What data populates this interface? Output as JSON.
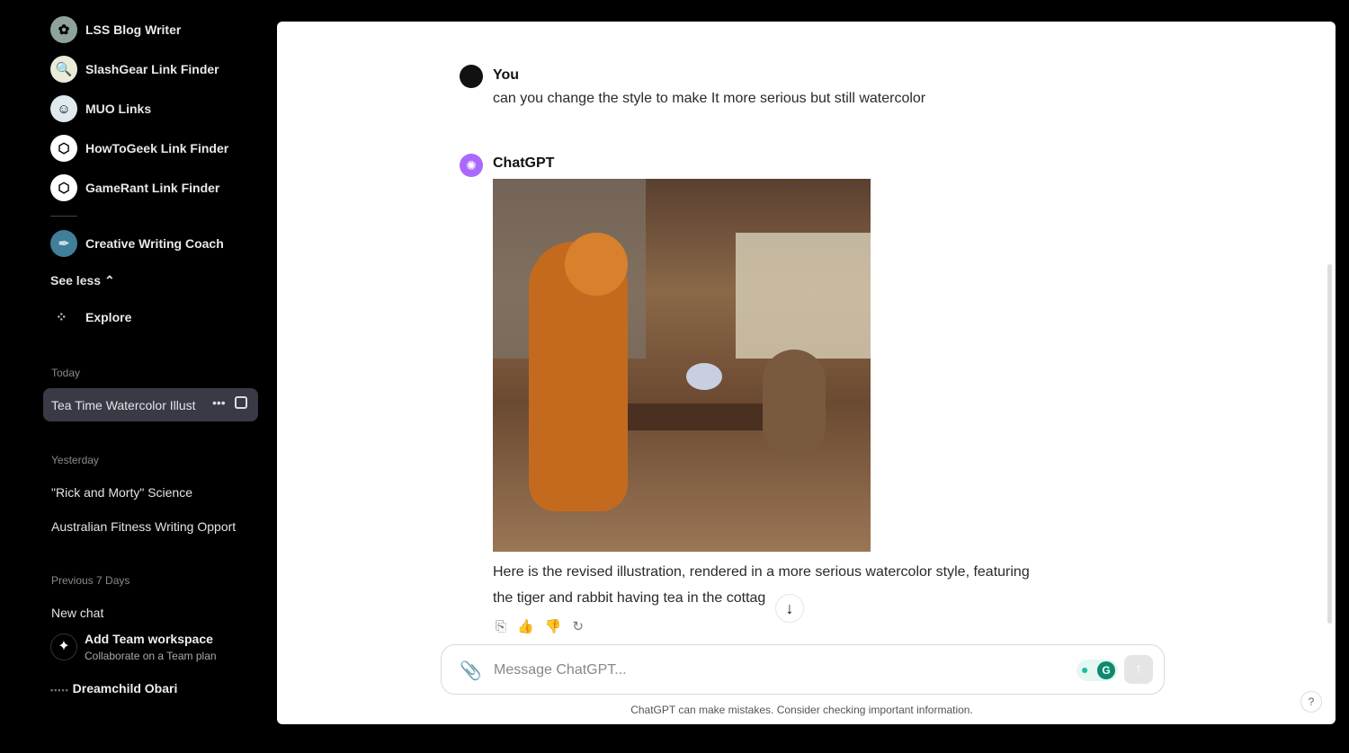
{
  "sidebar": {
    "gpts": [
      {
        "label": "LSS Blog Writer",
        "icon": "lss-avatar-icon"
      },
      {
        "label": "SlashGear Link Finder",
        "icon": "magnifier-avatar-icon"
      },
      {
        "label": "MUO Links",
        "icon": "robot-avatar-icon"
      },
      {
        "label": "HowToGeek Link Finder",
        "icon": "cube-icon"
      },
      {
        "label": "GameRant Link Finder",
        "icon": "cube-icon"
      },
      {
        "label": "Creative Writing Coach",
        "icon": "pen-nib-icon"
      }
    ],
    "see_less": "See less",
    "explore": "Explore",
    "today_label": "Today",
    "today_items": [
      "Tea Time Watercolor Illust"
    ],
    "yesterday_label": "Yesterday",
    "yesterday_items": [
      "\"Rick and Morty\" Science",
      "Australian Fitness Writing Opport"
    ],
    "prev7_label": "Previous 7 Days",
    "prev7_items": [
      "New chat"
    ],
    "team": {
      "title": "Add Team workspace",
      "subtitle": "Collaborate on a Team plan"
    },
    "user": "Dreamchild Obari"
  },
  "chat": {
    "user_name": "You",
    "user_message": "can you change the style to make It more serious but still watercolor",
    "assistant_name": "ChatGPT",
    "assistant_line1": "Here is the revised illustration, rendered in a more serious watercolor style, featuring",
    "assistant_line2": "the tiger and rabbit having tea in the cottag"
  },
  "composer": {
    "placeholder": "Message ChatGPT...",
    "disclaimer": "ChatGPT can make mistakes. Consider checking important information.",
    "help": "?"
  },
  "colors": {
    "accent_purple": "#ab68ff",
    "grammarly_green": "#15c39a"
  }
}
